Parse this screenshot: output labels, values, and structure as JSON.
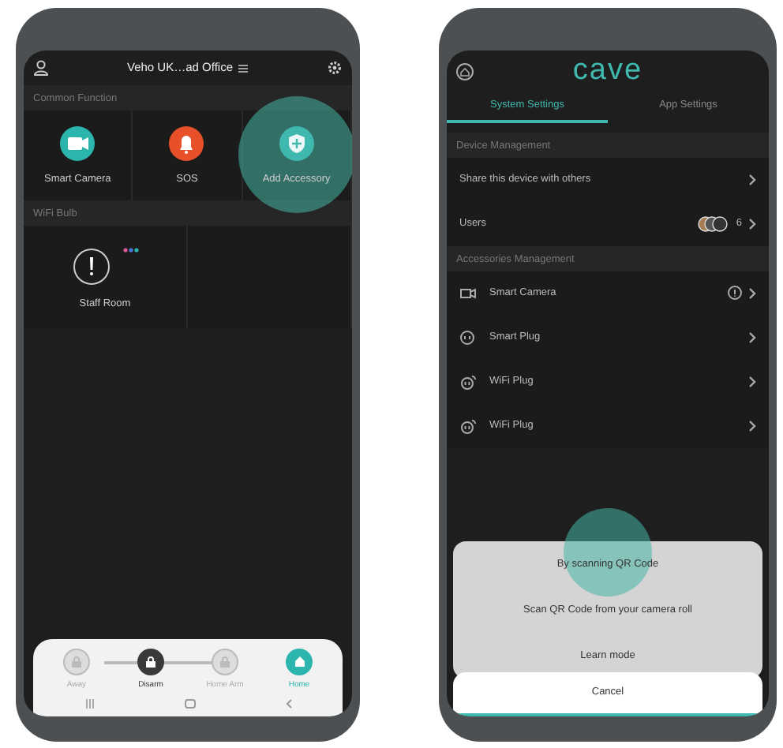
{
  "left_phone": {
    "header": {
      "title": "Veho UK…ad Office"
    },
    "common_function": {
      "heading": "Common Function",
      "tiles": [
        {
          "label": "Smart Camera",
          "kind": "camera",
          "color": "#2bb5ad",
          "touched": false
        },
        {
          "label": "SOS",
          "kind": "bell",
          "color": "#e8502a",
          "touched": false
        },
        {
          "label": "Add Accessory",
          "kind": "shield",
          "color": "#3fb8ae",
          "touched": true
        }
      ]
    },
    "wifi_bulb": {
      "heading": "WiFi Bulb",
      "tiles": [
        {
          "label": "Staff Room"
        }
      ]
    },
    "modes": [
      {
        "label": "Away",
        "selected": false
      },
      {
        "label": "Disarm",
        "selected": true
      },
      {
        "label": "Home Arm",
        "selected": false
      }
    ],
    "home_tab": {
      "label": "Home",
      "selected": true
    }
  },
  "right_phone": {
    "logo": "cave",
    "tabs": [
      {
        "label": "System Settings",
        "selected": true
      },
      {
        "label": "App Settings",
        "selected": false
      }
    ],
    "device_management": {
      "heading": "Device Management",
      "rows": [
        {
          "label": "Share this device with others",
          "kind": "link"
        },
        {
          "label": "Users",
          "kind": "users",
          "count": "6"
        }
      ]
    },
    "accessories_management": {
      "heading": "Accessories Management",
      "rows": [
        {
          "label": "Smart Camera",
          "kind": "camera",
          "alert": true
        },
        {
          "label": "Smart Plug",
          "kind": "plug",
          "alert": false
        },
        {
          "label": "WiFi Plug",
          "kind": "wifi-plug",
          "alert": false
        },
        {
          "label": "WiFi Plug",
          "kind": "wifi-plug",
          "alert": false
        }
      ]
    },
    "sheet": {
      "options": [
        {
          "label": "By scanning QR Code",
          "touched": true
        },
        {
          "label": "Scan QR Code from your camera roll",
          "touched": false
        },
        {
          "label": "Learn mode",
          "touched": false
        }
      ],
      "cancel": "Cancel"
    }
  }
}
